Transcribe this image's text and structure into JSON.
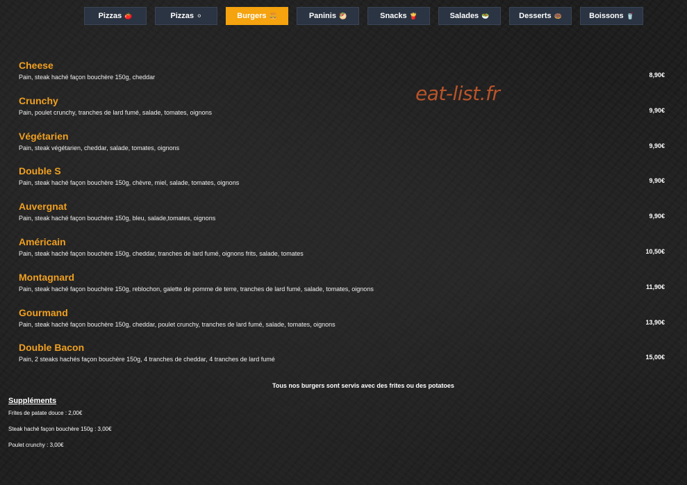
{
  "tabs": [
    {
      "label": "Pizzas",
      "icon": "🍅",
      "icon_name": "tomato-icon",
      "active": false
    },
    {
      "label": "Pizzas",
      "icon": "⚪",
      "icon_name": "white-circle-icon",
      "active": false
    },
    {
      "label": "Burgers",
      "icon": "🍔",
      "icon_name": "burger-icon",
      "active": true
    },
    {
      "label": "Paninis",
      "icon": "🥙",
      "icon_name": "panini-icon",
      "active": false
    },
    {
      "label": "Snacks",
      "icon": "🍟",
      "icon_name": "fries-icon",
      "active": false
    },
    {
      "label": "Salades",
      "icon": "🥗",
      "icon_name": "salad-icon",
      "active": false
    },
    {
      "label": "Desserts",
      "icon": "🍩",
      "icon_name": "donut-icon",
      "active": false
    },
    {
      "label": "Boissons",
      "icon": "🥤",
      "icon_name": "drink-icon",
      "active": false
    }
  ],
  "watermark": "eat-list.fr",
  "items": [
    {
      "name": "Cheese",
      "desc": "Pain, steak haché façon bouchère 150g, cheddar",
      "price": "8,90€"
    },
    {
      "name": "Crunchy",
      "desc": "Pain, poulet crunchy, tranches de lard fumé, salade, tomates, oignons",
      "price": "9,90€"
    },
    {
      "name": "Végétarien",
      "desc": "Pain, steak végétarien, cheddar, salade, tomates, oignons",
      "price": "9,90€"
    },
    {
      "name": "Double S",
      "desc": "Pain, steak haché façon bouchère 150g, chèvre, miel, salade, tomates, oignons",
      "price": "9,90€"
    },
    {
      "name": "Auvergnat",
      "desc": "Pain, steak haché façon bouchère 150g, bleu, salade,tomates, oignons",
      "price": "9,90€"
    },
    {
      "name": "Américain",
      "desc": "Pain, steak haché façon bouchère 150g, cheddar, tranches de lard fumé, oignons frits, salade, tomates",
      "price": "10,50€"
    },
    {
      "name": "Montagnard",
      "desc": "Pain, steak haché façon bouchère 150g, reblochon, galette de pomme de terre, tranches de lard fumé, salade, tomates, oignons",
      "price": "11,90€"
    },
    {
      "name": "Gourmand",
      "desc": "Pain, steak haché façon bouchère 150g, cheddar, poulet crunchy, tranches de lard fumé, salade, tomates, oignons",
      "price": "13,90€"
    },
    {
      "name": "Double Bacon",
      "desc": "Pain, 2 steaks hachés façon bouchère 150g, 4 tranches de cheddar, 4 tranches de lard fumé",
      "price": "15,00€"
    }
  ],
  "note": "Tous nos burgers sont servis avec des frites ou des potatoes",
  "supplements": {
    "title": "Suppléments",
    "lines": [
      "Frites de patate douce : 2,00€",
      "Steak haché façon bouchère 150g : 3,00€",
      "Poulet crunchy : 3,00€"
    ]
  },
  "colors": {
    "accent": "#f5a30e",
    "item_name": "#f0a020",
    "tab_bg": "#2b3442",
    "watermark": "#b8542a"
  }
}
